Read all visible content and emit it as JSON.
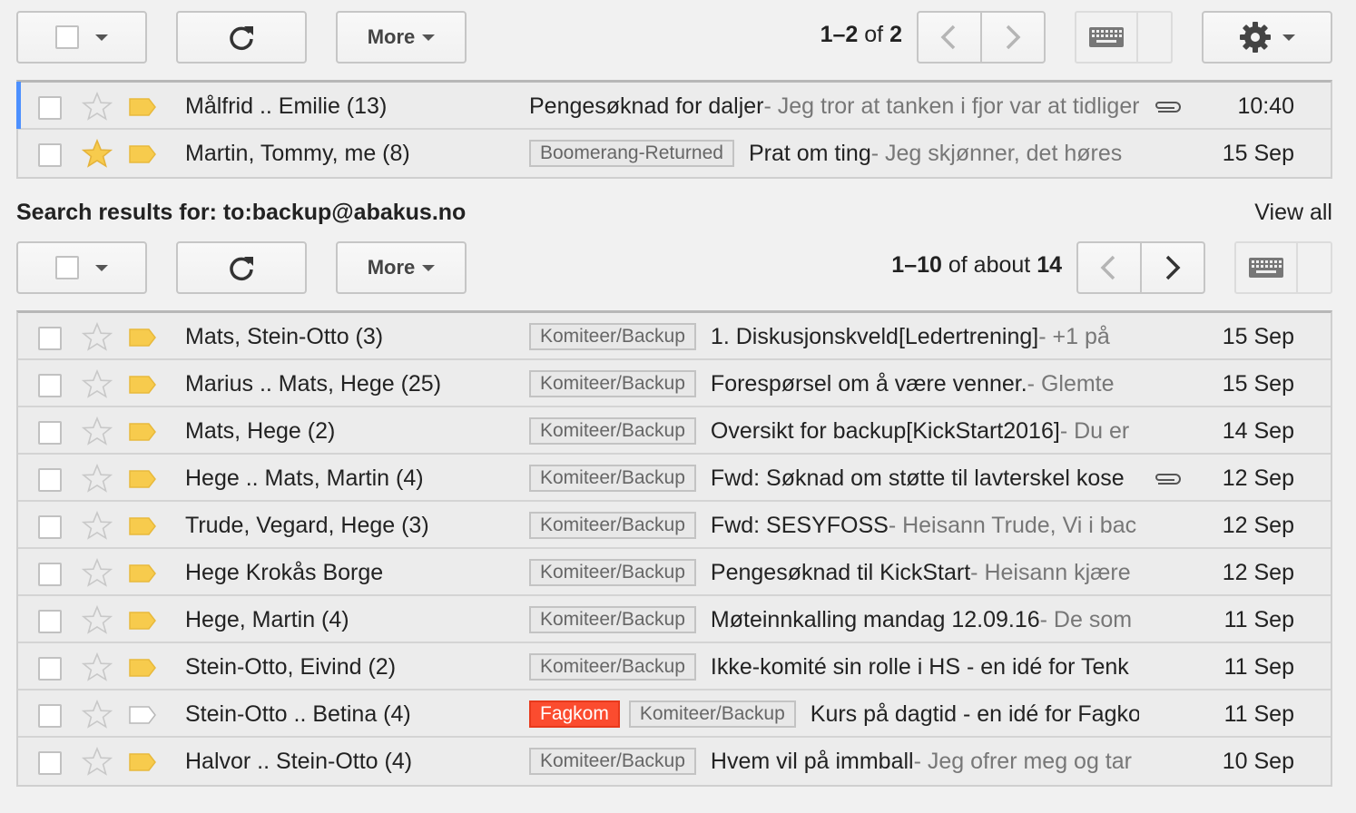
{
  "top_toolbar": {
    "more_label": "More",
    "pager": {
      "start": "1",
      "end": "2",
      "of": "of",
      "total": "2"
    }
  },
  "top_list": [
    {
      "sender": "Målfrid .. Emilie (13)",
      "labels": [],
      "subject": "Pengesøknad for daljer",
      "snippet": " - Jeg tror at tanken i fjor var at tidligere",
      "date": "10:40",
      "starred": false,
      "important": true,
      "attachment": true,
      "focused": true
    },
    {
      "sender": "Martin, Tommy, me (8)",
      "labels": [
        {
          "text": "Boomerang-Returned",
          "color": "gray"
        }
      ],
      "subject": "Prat om ting",
      "snippet": " - Jeg skjønner, det høres",
      "date": "15 Sep",
      "starred": true,
      "important": true,
      "attachment": false,
      "focused": false
    }
  ],
  "search": {
    "heading": "Search results for: to:backup@abakus.no",
    "view_all": "View all"
  },
  "bottom_toolbar": {
    "more_label": "More",
    "pager": {
      "start": "1",
      "end": "10",
      "of": "of about",
      "total": "14"
    }
  },
  "bottom_list": [
    {
      "sender": "Mats, Stein-Otto (3)",
      "labels": [
        {
          "text": "Komiteer/Backup",
          "color": "gray"
        }
      ],
      "subject": "1. Diskusjonskveld[Ledertrening]",
      "snippet": " - +1 på",
      "date": "15 Sep",
      "starred": false,
      "important": true,
      "attachment": false
    },
    {
      "sender": "Marius .. Mats, Hege (25)",
      "labels": [
        {
          "text": "Komiteer/Backup",
          "color": "gray"
        }
      ],
      "subject": "Forespørsel om å være venner.",
      "snippet": " - Glemte",
      "date": "15 Sep",
      "starred": false,
      "important": true,
      "attachment": false
    },
    {
      "sender": "Mats, Hege (2)",
      "labels": [
        {
          "text": "Komiteer/Backup",
          "color": "gray"
        }
      ],
      "subject": "Oversikt for backup[KickStart2016]",
      "snippet": " - Du er",
      "date": "14 Sep",
      "starred": false,
      "important": true,
      "attachment": false
    },
    {
      "sender": "Hege .. Mats, Martin (4)",
      "labels": [
        {
          "text": "Komiteer/Backup",
          "color": "gray"
        }
      ],
      "subject": "Fwd: Søknad om støtte til lavterskel kose",
      "snippet": "",
      "date": "12 Sep",
      "starred": false,
      "important": true,
      "attachment": true
    },
    {
      "sender": "Trude, Vegard, Hege (3)",
      "labels": [
        {
          "text": "Komiteer/Backup",
          "color": "gray"
        }
      ],
      "subject": "Fwd: SESYFOSS",
      "snippet": " - Heisann Trude, Vi i bac",
      "date": "12 Sep",
      "starred": false,
      "important": true,
      "attachment": false
    },
    {
      "sender": "Hege Krokås Borge",
      "labels": [
        {
          "text": "Komiteer/Backup",
          "color": "gray"
        }
      ],
      "subject": "Pengesøknad til KickStart",
      "snippet": " - Heisann kjære",
      "date": "12 Sep",
      "starred": false,
      "important": true,
      "attachment": false
    },
    {
      "sender": "Hege, Martin (4)",
      "labels": [
        {
          "text": "Komiteer/Backup",
          "color": "gray"
        }
      ],
      "subject": "Møteinnkalling mandag 12.09.16",
      "snippet": " - De som",
      "date": "11 Sep",
      "starred": false,
      "important": true,
      "attachment": false
    },
    {
      "sender": "Stein-Otto, Eivind (2)",
      "labels": [
        {
          "text": "Komiteer/Backup",
          "color": "gray"
        }
      ],
      "subject": "Ikke-komité sin rolle i HS - en idé for Tenk",
      "snippet": "",
      "date": "11 Sep",
      "starred": false,
      "important": true,
      "attachment": false
    },
    {
      "sender": "Stein-Otto .. Betina (4)",
      "labels": [
        {
          "text": "Fagkom",
          "color": "red"
        },
        {
          "text": "Komiteer/Backup",
          "color": "gray"
        }
      ],
      "subject": "Kurs på dagtid - en idé for Fagkom",
      "snippet": "",
      "date": "11 Sep",
      "starred": false,
      "important": false,
      "attachment": false
    },
    {
      "sender": "Halvor .. Stein-Otto (4)",
      "labels": [
        {
          "text": "Komiteer/Backup",
          "color": "gray"
        }
      ],
      "subject": "Hvem vil på immball",
      "snippet": " - Jeg ofrer meg og tar",
      "date": "10 Sep",
      "starred": false,
      "important": true,
      "attachment": false
    }
  ]
}
